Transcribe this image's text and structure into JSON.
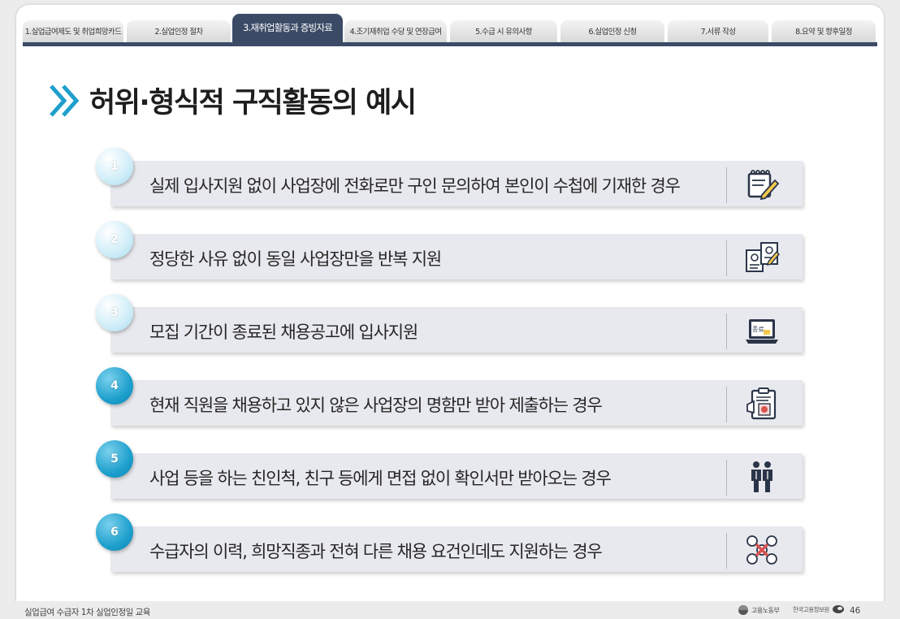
{
  "tabs": [
    {
      "label": "1.실업급여제도 및 취업희망카드"
    },
    {
      "label": "2.실업인정 절차"
    },
    {
      "label": "3.재취업활동과 증빙자료",
      "active": true
    },
    {
      "label": "4.조기재취업 수당 및 연장급여"
    },
    {
      "label": "5.수급 시 유의사항"
    },
    {
      "label": "6.실업인정 신청"
    },
    {
      "label": "7.서류 작성"
    },
    {
      "label": "8.요약 및 향후일정"
    }
  ],
  "page": {
    "title": "허위·형식적 구직활동의 예시"
  },
  "items": [
    {
      "number": "1",
      "text": "실제 입사지원 없이 사업장에 전화로만 구인 문의하여 본인이 수첩에 기재한 경우",
      "icon": "notepad-pencil-icon"
    },
    {
      "number": "2",
      "text": "정당한 사유 없이 동일 사업장만을 반복 지원",
      "icon": "resume-documents-icon"
    },
    {
      "number": "3",
      "text": "모집 기간이 종료된 채용공고에 입사지원",
      "icon": "laptop-closed-icon",
      "icon_label": "종료"
    },
    {
      "number": "4",
      "text": "현재 직원을 채용하고 있지 않은 사업장의 명함만 받아 제출하는 경우",
      "icon": "clipboard-card-icon"
    },
    {
      "number": "5",
      "text": "사업 등을 하는 친인척, 친구 등에게  면접 없이 확인서만 받아오는 경우",
      "icon": "two-people-icon"
    },
    {
      "number": "6",
      "text": "수급자의 이력, 희망직종과 전혀 다른 채용 요건인데도 지원하는 경우",
      "icon": "mismatch-network-icon"
    }
  ],
  "footer": {
    "course": "실업급여 수급자 1차 실업인정일 교육",
    "logo1": "고용노동부",
    "logo2": "한국고용정보원",
    "page_number": "46"
  },
  "colors": {
    "navy": "#3b4b66",
    "accent": "#1ea0cd",
    "bar": "#e8e9ee"
  }
}
